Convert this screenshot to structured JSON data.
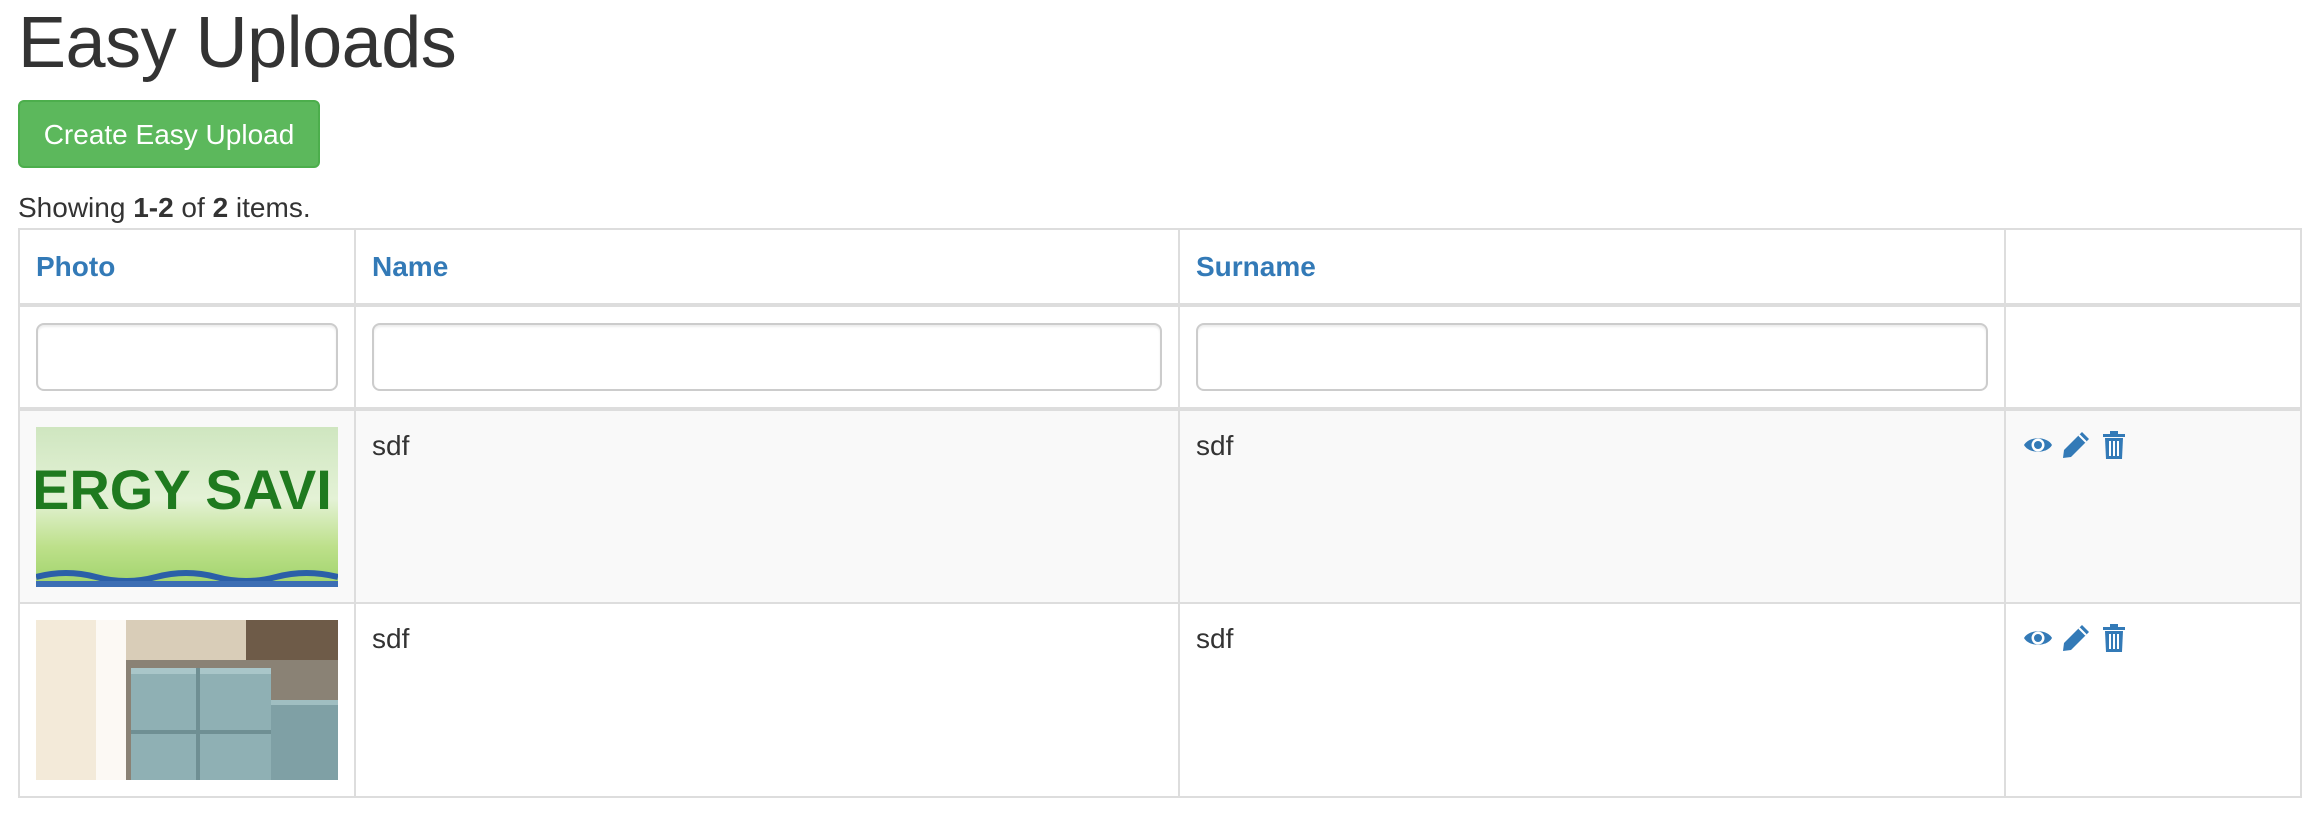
{
  "page": {
    "title": "Easy Uploads",
    "create_button": "Create Easy Upload"
  },
  "summary": {
    "prefix": "Showing ",
    "range": "1-2",
    "middle": " of ",
    "total": "2",
    "suffix": " items."
  },
  "table": {
    "columns": [
      "Photo",
      "Name",
      "Surname",
      ""
    ],
    "filters": {
      "photo": "",
      "name": "",
      "surname": ""
    },
    "rows": [
      {
        "photo_text": "ERGY SAVI",
        "name": "sdf",
        "surname": "sdf",
        "actions": [
          "eye-icon",
          "pencil-icon",
          "trash-icon"
        ]
      },
      {
        "name": "sdf",
        "surname": "sdf",
        "actions": [
          "eye-icon",
          "pencil-icon",
          "trash-icon"
        ]
      }
    ]
  },
  "colors": {
    "link": "#337ab7",
    "success": "#5cb85c",
    "border": "#dddddd",
    "stripe": "#f9f9f9"
  }
}
